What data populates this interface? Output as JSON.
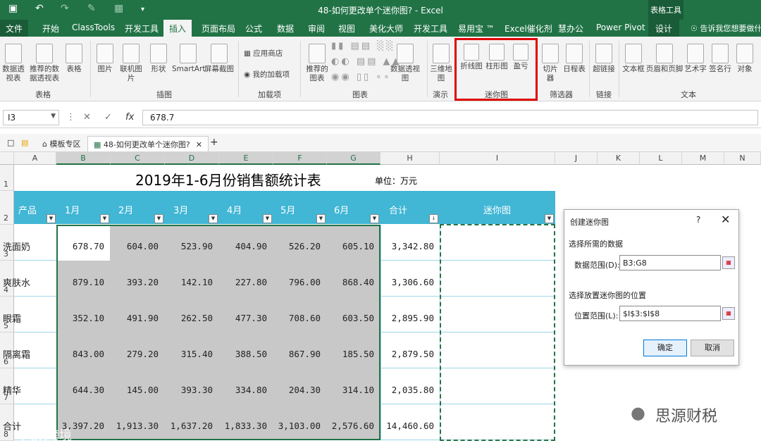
{
  "window": {
    "title": "48-如何更改单个迷你图? - Excel",
    "context_group": "表格工具",
    "search_hint": "告诉我您想要做什么"
  },
  "tabs": [
    "文件",
    "开始",
    "ClassTools",
    "开发工具",
    "插入",
    "页面布局",
    "公式",
    "数据",
    "审阅",
    "视图",
    "美化大师",
    "开发工具",
    "易用宝 ™",
    "Excel催化剂",
    "慧办公",
    "Power Pivot",
    "设计"
  ],
  "ribbon": {
    "table_group": {
      "label": "表格",
      "buttons": [
        "数据透视表",
        "推荐的数据透视表",
        "表格"
      ]
    },
    "illustrations_group": {
      "label": "插图",
      "buttons": [
        "图片",
        "联机图片",
        "形状",
        "SmartArt",
        "屏幕截图"
      ]
    },
    "addins_group": {
      "label": "加载项",
      "buttons": [
        "应用商店",
        "我的加载项"
      ]
    },
    "charts_group": {
      "label": "图表",
      "buttons": [
        "推荐的图表",
        "数据透视图"
      ]
    },
    "tours_group": {
      "label": "演示",
      "buttons": [
        "三维地图"
      ]
    },
    "sparkline_group": {
      "label": "迷你图",
      "buttons": [
        "折线图",
        "柱形图",
        "盈亏"
      ]
    },
    "filter_group": {
      "label": "筛选器",
      "buttons": [
        "切片器",
        "日程表"
      ]
    },
    "links_group": {
      "label": "链接",
      "buttons": [
        "超链接"
      ]
    },
    "text_group": {
      "label": "文本",
      "buttons": [
        "文本框",
        "页眉和页脚",
        "艺术字",
        "签名行",
        "对象"
      ]
    }
  },
  "formula_bar": {
    "name_box": "I3",
    "formula": "678.7"
  },
  "doc_tabs": [
    "模板专区",
    "48-如何更改单个迷你图?"
  ],
  "columns": [
    "A",
    "B",
    "C",
    "D",
    "E",
    "F",
    "G",
    "H",
    "I",
    "J",
    "K",
    "L",
    "M",
    "N"
  ],
  "sheet": {
    "title": "2019年1-6月份销售额统计表",
    "unit": "单位：万元",
    "headers": [
      "产品",
      "1月",
      "2月",
      "3月",
      "4月",
      "5月",
      "6月",
      "合计",
      "迷你图"
    ],
    "rows": [
      {
        "product": "洗面奶",
        "values": [
          "678.70",
          "604.00",
          "523.90",
          "404.90",
          "526.20",
          "605.10"
        ],
        "total": "3,342.80"
      },
      {
        "product": "爽肤水",
        "values": [
          "879.10",
          "393.20",
          "142.10",
          "227.80",
          "796.00",
          "868.40"
        ],
        "total": "3,306.60"
      },
      {
        "product": "眼霜",
        "values": [
          "352.10",
          "491.90",
          "262.50",
          "477.30",
          "708.60",
          "603.50"
        ],
        "total": "2,895.90"
      },
      {
        "product": "隔离霜",
        "values": [
          "843.00",
          "279.20",
          "315.40",
          "388.50",
          "867.90",
          "185.50"
        ],
        "total": "2,879.50"
      },
      {
        "product": "精华",
        "values": [
          "644.30",
          "145.00",
          "393.30",
          "334.80",
          "204.30",
          "314.10"
        ],
        "total": "2,035.80"
      },
      {
        "product": "合计",
        "values": [
          "3,397.20",
          "1,913.30",
          "1,637.20",
          "1,833.30",
          "3,103.00",
          "2,576.60"
        ],
        "total": "14,460.60"
      }
    ]
  },
  "dialog": {
    "title": "创建迷你图",
    "help": "?",
    "close": "✕",
    "section1": "选择所需的数据",
    "data_range_label": "数据范围(D):",
    "data_range_value": "B3:G8",
    "section2": "选择放置迷你图的位置",
    "location_label": "位置范围(L):",
    "location_value": "$I$3:$I$8",
    "ok": "确定",
    "cancel": "取消"
  },
  "watermarks": {
    "main": "思源财税",
    "corner": "大数跨境"
  },
  "colors": {
    "excel_green": "#217346",
    "header_band": "#41b6d5",
    "selection_gray": "#c8c8c8",
    "highlight_red": "#e00000"
  }
}
